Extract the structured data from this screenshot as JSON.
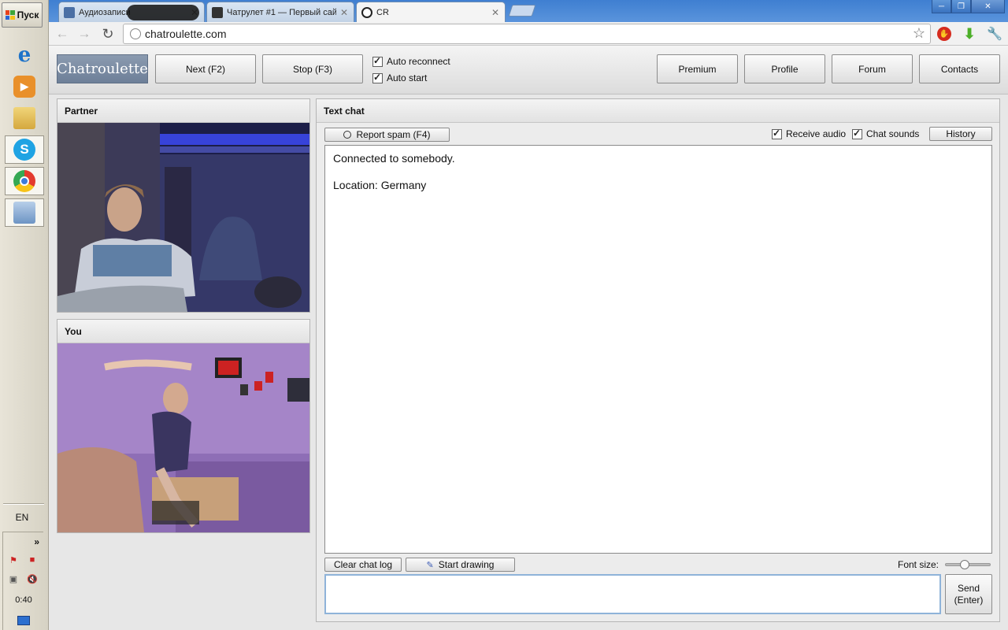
{
  "taskbar": {
    "start_label": "Пуск",
    "apps": [
      {
        "name": "internet-explorer-icon",
        "glyph": "e",
        "color": "#1e73c9"
      },
      {
        "name": "media-player-icon",
        "glyph": "▶",
        "color": "#e48a1d"
      },
      {
        "name": "file-manager-icon",
        "glyph": "",
        "color": "#d9b44a"
      },
      {
        "name": "skype-icon",
        "glyph": "S",
        "color": "#1fa3e3"
      },
      {
        "name": "chrome-icon",
        "glyph": "",
        "color": "#e33b2e"
      },
      {
        "name": "network-tool-icon",
        "glyph": "",
        "color": "#6d94c4"
      }
    ],
    "language": "EN",
    "clock": "0:40"
  },
  "browser": {
    "tabs": [
      {
        "title": "Аудиозаписи",
        "active": false
      },
      {
        "title": "Чатрулет #1 — Первый сай",
        "active": false
      },
      {
        "title": "CR",
        "active": true
      }
    ],
    "url": "chatroulette.com"
  },
  "page": {
    "logo": "Chatroulette",
    "next_label": "Next (F2)",
    "stop_label": "Stop (F3)",
    "auto_reconnect": "Auto reconnect",
    "auto_start": "Auto start",
    "nav": [
      "Premium",
      "Profile",
      "Forum",
      "Contacts"
    ],
    "partner_title": "Partner",
    "you_title": "You",
    "text_chat_title": "Text chat",
    "report_spam": "Report spam (F4)",
    "receive_audio": "Receive audio",
    "chat_sounds": "Chat sounds",
    "history": "History",
    "chat_log": [
      "Connected to somebody.",
      "Location: Germany"
    ],
    "clear_chat_log": "Clear chat log",
    "start_drawing": "Start drawing",
    "font_size": "Font size:",
    "send_line1": "Send",
    "send_line2": "(Enter)"
  }
}
